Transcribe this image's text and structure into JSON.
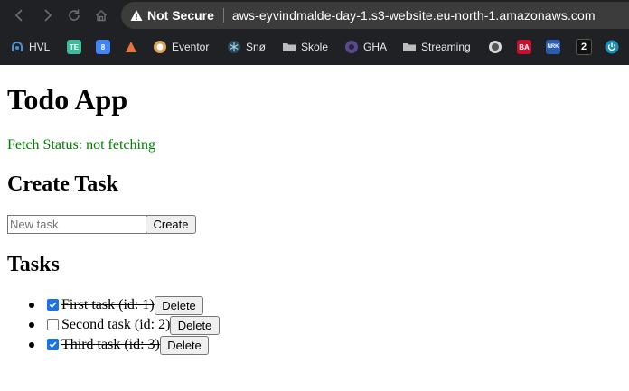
{
  "browser": {
    "security_label": "Not Secure",
    "url": "aws-eyvindmalde-day-1.s3-website.eu-north-1.amazonaws.com",
    "bookmarks": [
      {
        "label": "HVL",
        "icon": "hvl-icon"
      },
      {
        "label": "",
        "icon": "te-icon",
        "text": "TE"
      },
      {
        "label": "",
        "icon": "calendar-icon",
        "text": "8"
      },
      {
        "label": "",
        "icon": "triangle-icon"
      },
      {
        "label": "Eventor",
        "icon": "eventor-icon"
      },
      {
        "label": "Snø",
        "icon": "snowflake-icon"
      },
      {
        "label": "Skole",
        "icon": "folder-icon"
      },
      {
        "label": "GHA",
        "icon": "gha-icon"
      },
      {
        "label": "Streaming",
        "icon": "folder-icon"
      },
      {
        "label": "",
        "icon": "globe-icon"
      },
      {
        "label": "",
        "icon": "ba-icon",
        "text": "BA"
      },
      {
        "label": "",
        "icon": "nrk-icon",
        "text": "NRK"
      },
      {
        "label": "",
        "icon": "tv2-icon",
        "text": "2"
      },
      {
        "label": "",
        "icon": "power-icon"
      }
    ]
  },
  "app": {
    "title": "Todo App",
    "fetch_status": "Fetch Status: not fetching",
    "create_heading": "Create Task",
    "new_task_placeholder": "New task",
    "create_button": "Create",
    "tasks_heading": "Tasks",
    "tasks": [
      {
        "text": "First task (id: 1)",
        "done": true,
        "delete_label": "Delete"
      },
      {
        "text": "Second task (id: 2)",
        "done": false,
        "delete_label": "Delete"
      },
      {
        "text": "Third task (id: 3)",
        "done": true,
        "delete_label": "Delete"
      }
    ]
  },
  "colors": {
    "chrome_bg": "#202124",
    "omnibox_bg": "#3c3c3c",
    "status_green": "#008000",
    "checkbox_blue": "#1a73e8"
  }
}
